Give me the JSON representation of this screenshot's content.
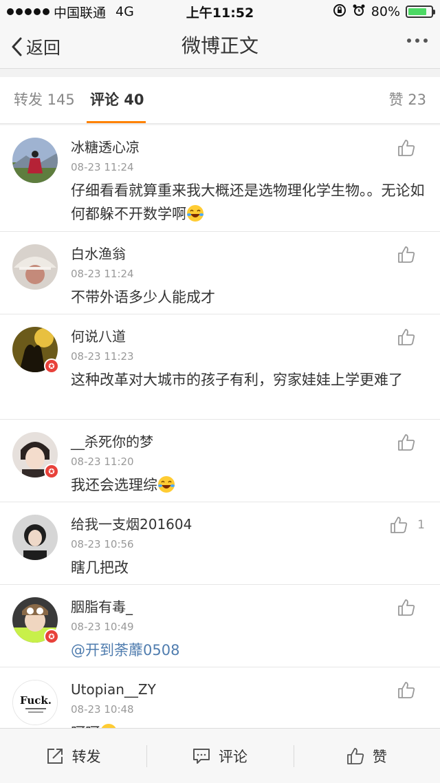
{
  "status_bar": {
    "carrier": "中国联通",
    "network": "4G",
    "time": "上午11:52",
    "battery": "80%",
    "battery_level": 0.8
  },
  "nav": {
    "back_label": "返回",
    "title": "微博正文"
  },
  "tabs": {
    "repost": "转发 145",
    "comment": "评论 40",
    "like": "赞 23"
  },
  "comments": [
    {
      "name": "冰糖透心凉",
      "time": "08-23 11:24",
      "text": "仔细看看就算重来我大概还是选物理化学生物。。无论如何都躲不开数学啊",
      "likes": ""
    },
    {
      "name": "白水渔翁",
      "time": "08-23 11:24",
      "text": "不带外语多少人能成才",
      "likes": ""
    },
    {
      "name": "何说八道",
      "time": "08-23 11:23",
      "text": "这种改革对大城市的孩子有利，穷家娃娃上学更难了",
      "likes": ""
    },
    {
      "name": "__杀死你的梦",
      "time": "08-23 11:20",
      "text": "我还会选理综",
      "likes": ""
    },
    {
      "name": "给我一支烟201604",
      "time": "08-23 10:56",
      "text": "瞎几把改",
      "likes": "1"
    },
    {
      "name": "胭脂有毒_",
      "time": "08-23 10:49",
      "text": "@开到荼蘼0508",
      "likes": ""
    },
    {
      "name": "Utopian__ZY",
      "time": "08-23 10:48",
      "text": "呵呵",
      "likes": ""
    }
  ],
  "avatar_7_text": "Fuck.",
  "toolbar": {
    "repost": "转发",
    "comment": "评论",
    "like": "赞"
  }
}
